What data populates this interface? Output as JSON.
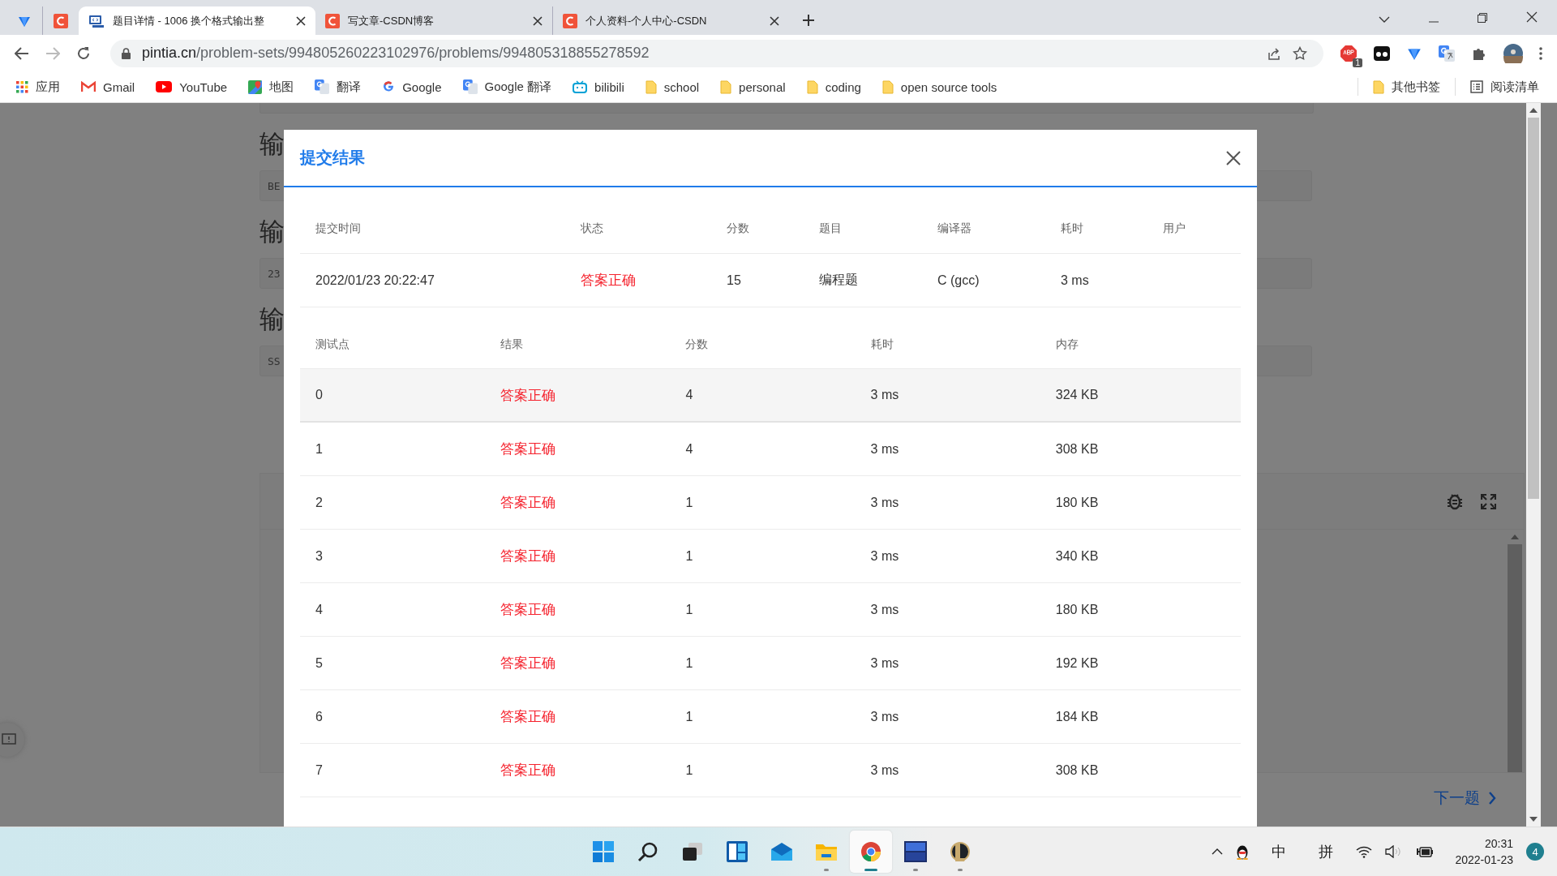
{
  "tabs": [
    {
      "kind": "gem",
      "selected": false
    },
    {
      "kind": "c-logo",
      "selected": false
    },
    {
      "kind": "code",
      "title": "题目详情 - 1006 换个格式输出整",
      "selected": true
    },
    {
      "kind": "c-logo",
      "title": "写文章-CSDN博客",
      "selected": false
    },
    {
      "kind": "c-logo",
      "title": "个人资料-个人中心-CSDN",
      "selected": false
    }
  ],
  "address": {
    "host": "pintia.cn",
    "path": "/problem-sets/994805260223102976/problems/994805318855278592"
  },
  "extensions": {
    "adblock_badge": "1"
  },
  "bookmarks": [
    {
      "kind": "apps",
      "label": "应用"
    },
    {
      "kind": "gmail",
      "label": "Gmail"
    },
    {
      "kind": "youtube",
      "label": "YouTube"
    },
    {
      "kind": "maps",
      "label": "地图"
    },
    {
      "kind": "translate",
      "label": "翻译"
    },
    {
      "kind": "google",
      "label": "Google"
    },
    {
      "kind": "translate",
      "label": "Google 翻译"
    },
    {
      "kind": "bilibili",
      "label": "bilibili"
    },
    {
      "kind": "folder",
      "label": "school"
    },
    {
      "kind": "folder",
      "label": "personal"
    },
    {
      "kind": "folder",
      "label": "coding"
    },
    {
      "kind": "folder",
      "label": "open source tools"
    }
  ],
  "other_bookmarks": "其他书签",
  "reading_list": "阅读清单",
  "page": {
    "sections": [
      {
        "heading": "输",
        "field": "BE"
      },
      {
        "heading": "输",
        "field": "23"
      },
      {
        "heading": "输",
        "field": "SS"
      }
    ],
    "next_link": "下一题"
  },
  "dialog": {
    "title": "提交结果",
    "summary": {
      "columns": [
        "提交时间",
        "状态",
        "分数",
        "题目",
        "编译器",
        "耗时",
        "用户"
      ],
      "rows": [
        {
          "time": "2022/01/23 20:22:47",
          "status": "答案正确",
          "score": "15",
          "problem": "编程题",
          "compiler": "C (gcc)",
          "duration": "3 ms"
        }
      ]
    },
    "tests": {
      "columns": [
        "测试点",
        "结果",
        "分数",
        "耗时",
        "内存"
      ],
      "rows": [
        {
          "case": "0",
          "result": "答案正确",
          "score": "4",
          "time": "3 ms",
          "memory": "324 KB",
          "hovered": true
        },
        {
          "case": "1",
          "result": "答案正确",
          "score": "4",
          "time": "3 ms",
          "memory": "308 KB",
          "hovered": false
        },
        {
          "case": "2",
          "result": "答案正确",
          "score": "1",
          "time": "3 ms",
          "memory": "180 KB",
          "hovered": false
        },
        {
          "case": "3",
          "result": "答案正确",
          "score": "1",
          "time": "3 ms",
          "memory": "340 KB",
          "hovered": false
        },
        {
          "case": "4",
          "result": "答案正确",
          "score": "1",
          "time": "3 ms",
          "memory": "180 KB",
          "hovered": false
        },
        {
          "case": "5",
          "result": "答案正确",
          "score": "1",
          "time": "3 ms",
          "memory": "192 KB",
          "hovered": false
        },
        {
          "case": "6",
          "result": "答案正确",
          "score": "1",
          "time": "3 ms",
          "memory": "184 KB",
          "hovered": false
        },
        {
          "case": "7",
          "result": "答案正确",
          "score": "1",
          "time": "3 ms",
          "memory": "308 KB",
          "hovered": false
        }
      ]
    }
  },
  "taskbar": {
    "apps": [
      {
        "kind": "start",
        "running": false,
        "active": false
      },
      {
        "kind": "search",
        "running": false,
        "active": false
      },
      {
        "kind": "taskview",
        "running": false,
        "active": false
      },
      {
        "kind": "widgets",
        "running": false,
        "active": false
      },
      {
        "kind": "mail",
        "running": false,
        "active": false
      },
      {
        "kind": "explorer",
        "running": true,
        "active": false
      },
      {
        "kind": "chrome",
        "running": true,
        "active": true
      },
      {
        "kind": "devcpp",
        "running": true,
        "active": false
      },
      {
        "kind": "game",
        "running": true,
        "active": false
      }
    ],
    "input_mode": "中",
    "ime": "拼",
    "time": "20:31",
    "date": "2022-01-23",
    "notifications": "4"
  }
}
